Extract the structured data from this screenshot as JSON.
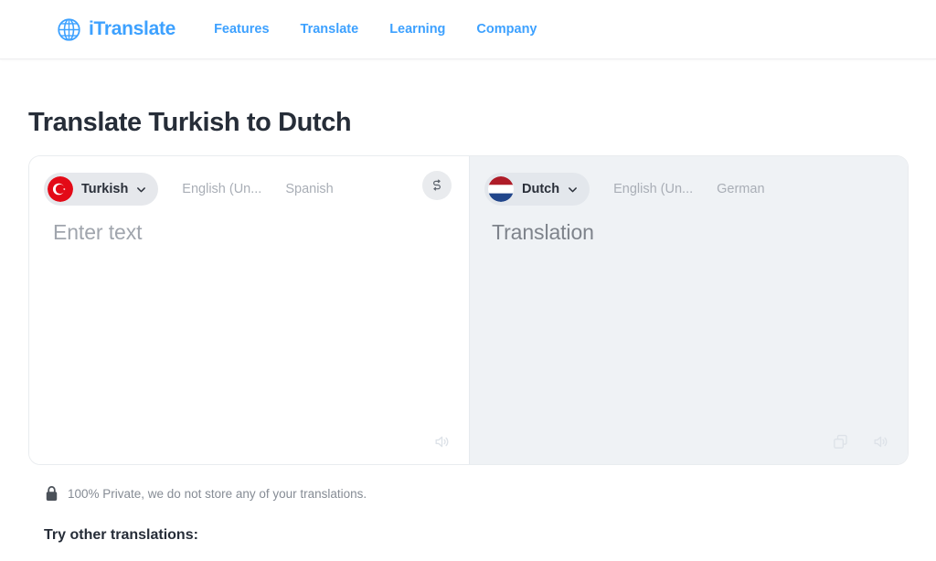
{
  "header": {
    "brand": "iTranslate",
    "logo_icon": "globe-icon",
    "nav": [
      {
        "label": "Features"
      },
      {
        "label": "Translate"
      },
      {
        "label": "Learning"
      },
      {
        "label": "Company"
      }
    ],
    "brand_color": "#3DA1FF"
  },
  "main": {
    "title": "Translate Turkish to Dutch",
    "source": {
      "selected_language": "Turkish",
      "flag": "turkey-flag-icon",
      "dropdown_icon": "chevron-down-icon",
      "alt_languages": [
        "English (Un...",
        "Spanish"
      ],
      "placeholder": "Enter text",
      "tools": [
        {
          "icon": "speaker-icon",
          "name": "listen-source-button"
        }
      ]
    },
    "swap": {
      "icon": "swap-languages-icon",
      "name": "swap-languages-button"
    },
    "target": {
      "selected_language": "Dutch",
      "flag": "netherlands-flag-icon",
      "dropdown_icon": "chevron-down-icon",
      "alt_languages": [
        "English (Un...",
        "German"
      ],
      "placeholder": "Translation",
      "tools": [
        {
          "icon": "copy-icon",
          "name": "copy-translation-button"
        },
        {
          "icon": "speaker-icon",
          "name": "listen-translation-button"
        }
      ]
    }
  },
  "footer": {
    "privacy_icon": "lock-icon",
    "privacy_text": "100% Private, we do not store any of your translations.",
    "try_other_title": "Try other translations:"
  },
  "colors": {
    "accent": "#3DA1FF",
    "panel_target_bg": "#eff2f5",
    "pill_bg": "#e6e8ec",
    "title": "#262d38",
    "muted": "#a9aeb6"
  }
}
